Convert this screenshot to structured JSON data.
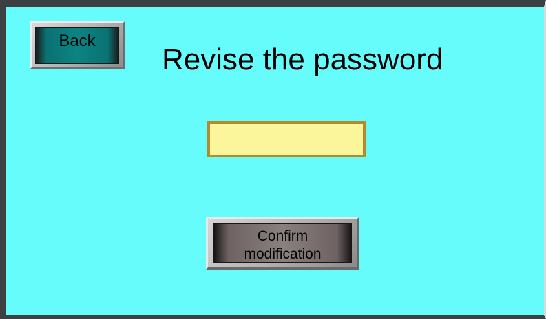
{
  "screen": {
    "title": "Revise the password",
    "back_button": {
      "label": "Back"
    },
    "password_field": {
      "value": "",
      "placeholder": ""
    },
    "confirm_button": {
      "label": "Confirm\nmodification"
    }
  },
  "colors": {
    "background": "#66fcfb",
    "frame": "#3c4043",
    "back_face": "#0c8383",
    "input_fill": "#fbf59c",
    "input_border": "#b68a2a",
    "confirm_face": "#8a8080"
  }
}
